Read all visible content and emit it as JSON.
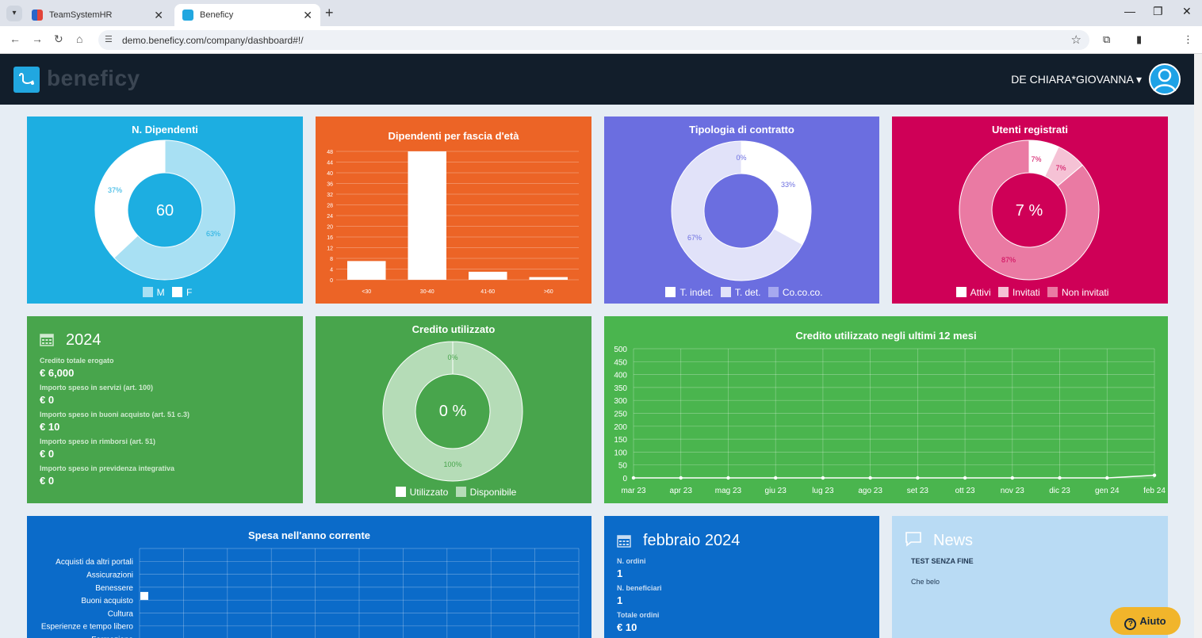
{
  "browser": {
    "tabs": [
      {
        "title": "TeamSystemHR",
        "active": false
      },
      {
        "title": "Beneficy",
        "active": true
      }
    ],
    "url": "demo.beneficy.com/company/dashboard#!/"
  },
  "header": {
    "logo": "beneficy",
    "user": "DE CHIARA*GIOVANNA"
  },
  "colors": {
    "dipendenti": "#1daee1",
    "fascia": "#ec6426",
    "contratto": "#6b6ee0",
    "utenti": "#cf0057",
    "anno": "#48a54c",
    "credito": "#48a54c",
    "ultimi12": "#4ab54e",
    "spesa": "#0b6bc9",
    "mese": "#0b6bc9",
    "news": "#b9dbf4"
  },
  "cards": {
    "dipendenti": {
      "title": "N. Dipendenti",
      "center": "60",
      "labels": [
        "37%",
        "63%"
      ],
      "legend": [
        "M",
        "F"
      ]
    },
    "fascia": {
      "title": "Dipendenti per fascia d'età"
    },
    "contratto": {
      "title": "Tipologia di contratto",
      "labels": [
        "0%",
        "33%",
        "67%"
      ],
      "legend": [
        "T. indet.",
        "T. det.",
        "Co.co.co."
      ]
    },
    "utenti": {
      "title": "Utenti registrati",
      "center": "7 %",
      "labels": [
        "7%",
        "7%",
        "87%"
      ],
      "legend": [
        "Attivi",
        "Invitati",
        "Non invitati"
      ]
    },
    "anno": {
      "year": "2024",
      "items": [
        {
          "label": "Credito totale erogato",
          "value": "€ 6,000"
        },
        {
          "label": "Importo speso in servizi (art. 100)",
          "value": "€ 0"
        },
        {
          "label": "Importo speso in buoni acquisto (art. 51 c.3)",
          "value": "€ 10"
        },
        {
          "label": "Importo speso in rimborsi (art. 51)",
          "value": "€ 0"
        },
        {
          "label": "Importo speso in previdenza integrativa",
          "value": "€ 0"
        }
      ]
    },
    "credito": {
      "title": "Credito utilizzato",
      "center": "0 %",
      "labels": [
        "0%",
        "100%"
      ],
      "legend": [
        "Utilizzato",
        "Disponibile"
      ]
    },
    "ultimi12": {
      "title": "Credito utilizzato negli ultimi 12 mesi"
    },
    "spesa": {
      "title": "Spesa nell'anno corrente",
      "rows": [
        "Acquisti da altri portali",
        "Assicurazioni",
        "Benessere",
        "Buoni acquisto",
        "Cultura",
        "Esperienze e tempo libero",
        "Formazione"
      ]
    },
    "mese": {
      "month": "febbraio 2024",
      "items": [
        {
          "label": "N. ordini",
          "value": "1"
        },
        {
          "label": "N. beneficiari",
          "value": "1"
        },
        {
          "label": "Totale ordini",
          "value": "€ 10"
        }
      ]
    },
    "news": {
      "title": "News",
      "headline": "TEST SENZA FINE",
      "body": "Che belo"
    }
  },
  "help": {
    "label": "Aiuto"
  },
  "chart_data": [
    {
      "type": "pie",
      "title": "N. Dipendenti",
      "categories": [
        "M",
        "F"
      ],
      "values": [
        37,
        63
      ]
    },
    {
      "type": "bar",
      "title": "Dipendenti per fascia d'età",
      "categories": [
        "<30",
        "30-40",
        "41-60",
        ">60"
      ],
      "values": [
        7,
        48,
        3,
        1
      ],
      "ylim": [
        0,
        48
      ],
      "yticks": [
        0,
        4,
        8,
        12,
        16,
        20,
        24,
        28,
        32,
        36,
        40,
        44,
        48
      ]
    },
    {
      "type": "pie",
      "title": "Tipologia di contratto",
      "categories": [
        "T. indet.",
        "T. det.",
        "Co.co.co."
      ],
      "values": [
        67,
        33,
        0
      ]
    },
    {
      "type": "pie",
      "title": "Utenti registrati",
      "categories": [
        "Attivi",
        "Invitati",
        "Non invitati"
      ],
      "values": [
        7,
        7,
        87
      ]
    },
    {
      "type": "pie",
      "title": "Credito utilizzato",
      "categories": [
        "Utilizzato",
        "Disponibile"
      ],
      "values": [
        0,
        100
      ]
    },
    {
      "type": "line",
      "title": "Credito utilizzato negli ultimi 12 mesi",
      "x": [
        "mar 23",
        "apr 23",
        "mag 23",
        "giu 23",
        "lug 23",
        "ago 23",
        "set 23",
        "ott 23",
        "nov 23",
        "dic 23",
        "gen 24",
        "feb 24"
      ],
      "values": [
        0,
        0,
        0,
        0,
        0,
        0,
        0,
        0,
        0,
        0,
        0,
        10
      ],
      "ylim": [
        0,
        500
      ],
      "yticks": [
        0,
        50,
        100,
        150,
        200,
        250,
        300,
        350,
        400,
        450,
        500
      ]
    }
  ]
}
